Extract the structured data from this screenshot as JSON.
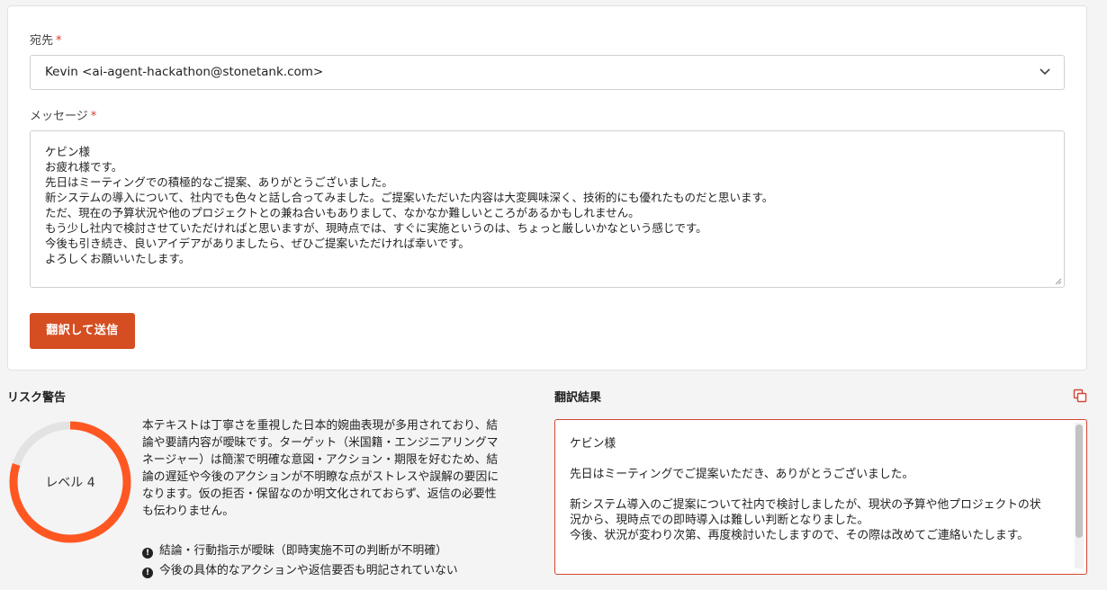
{
  "form": {
    "recipient_label": "宛先",
    "recipient_value": "Kevin <ai-agent-hackathon@stonetank.com>",
    "message_label": "メッセージ",
    "required_mark": "*",
    "message_lines": [
      "ケビン様",
      "お疲れ様です。",
      "先日はミーティングでの積極的なご提案、ありがとうございました。",
      "新システムの導入について、社内でも色々と話し合ってみました。ご提案いただいた内容は大変興味深く、技術的にも優れたものだと思います。",
      "ただ、現在の予算状況や他のプロジェクトとの兼ね合いもありまして、なかなか難しいところがあるかもしれません。",
      "もう少し社内で検討させていただければと思いますが、現時点では、すぐに実施というのは、ちょっと厳しいかなという感じです。",
      "今後も引き続き、良いアイデアがありましたら、ぜひご提案いただければ幸いです。",
      "よろしくお願いいたします。"
    ],
    "submit_label": "翻訳して送信"
  },
  "risk": {
    "title": "リスク警告",
    "level_label": "レベル 4",
    "level_fraction": 0.8,
    "desc_lines": [
      "本テキストは丁寧さを重視した日本的婉曲表現が多用されており、結",
      "論や要請内容が曖昧です。ターゲット（米国籍・エンジニアリングマ",
      "ネージャー）は簡潔で明確な意図・アクション・期限を好むため、結",
      "論の遅延や今後のアクションが不明瞭な点がストレスや誤解の要因に",
      "なります。仮の拒否・保留なのか明文化されておらず、返信の必要性",
      "も伝わりません。"
    ],
    "items": [
      "結論・行動指示が曖昧（即時実施不可の判断が不明確）",
      "今後の具体的なアクションや返信要否も明記されていない"
    ],
    "accent_color": "#ff5722"
  },
  "translation": {
    "title": "翻訳結果",
    "paragraphs": [
      "ケビン様",
      "先日はミーティングでご提案いただき、ありがとうございました。",
      "新システム導入のご提案について社内で検討しましたが、現状の予算や他プロジェクトの状況から、現時点での即時導入は難しい判断となりました。",
      "今後、状況が変わり次第、再度検討いたしますので、その際は改めてご連絡いたします。"
    ]
  },
  "icons": {
    "dropdown": "chevron-down-icon",
    "copy": "copy-icon",
    "warning": "exclamation-circle-icon"
  }
}
